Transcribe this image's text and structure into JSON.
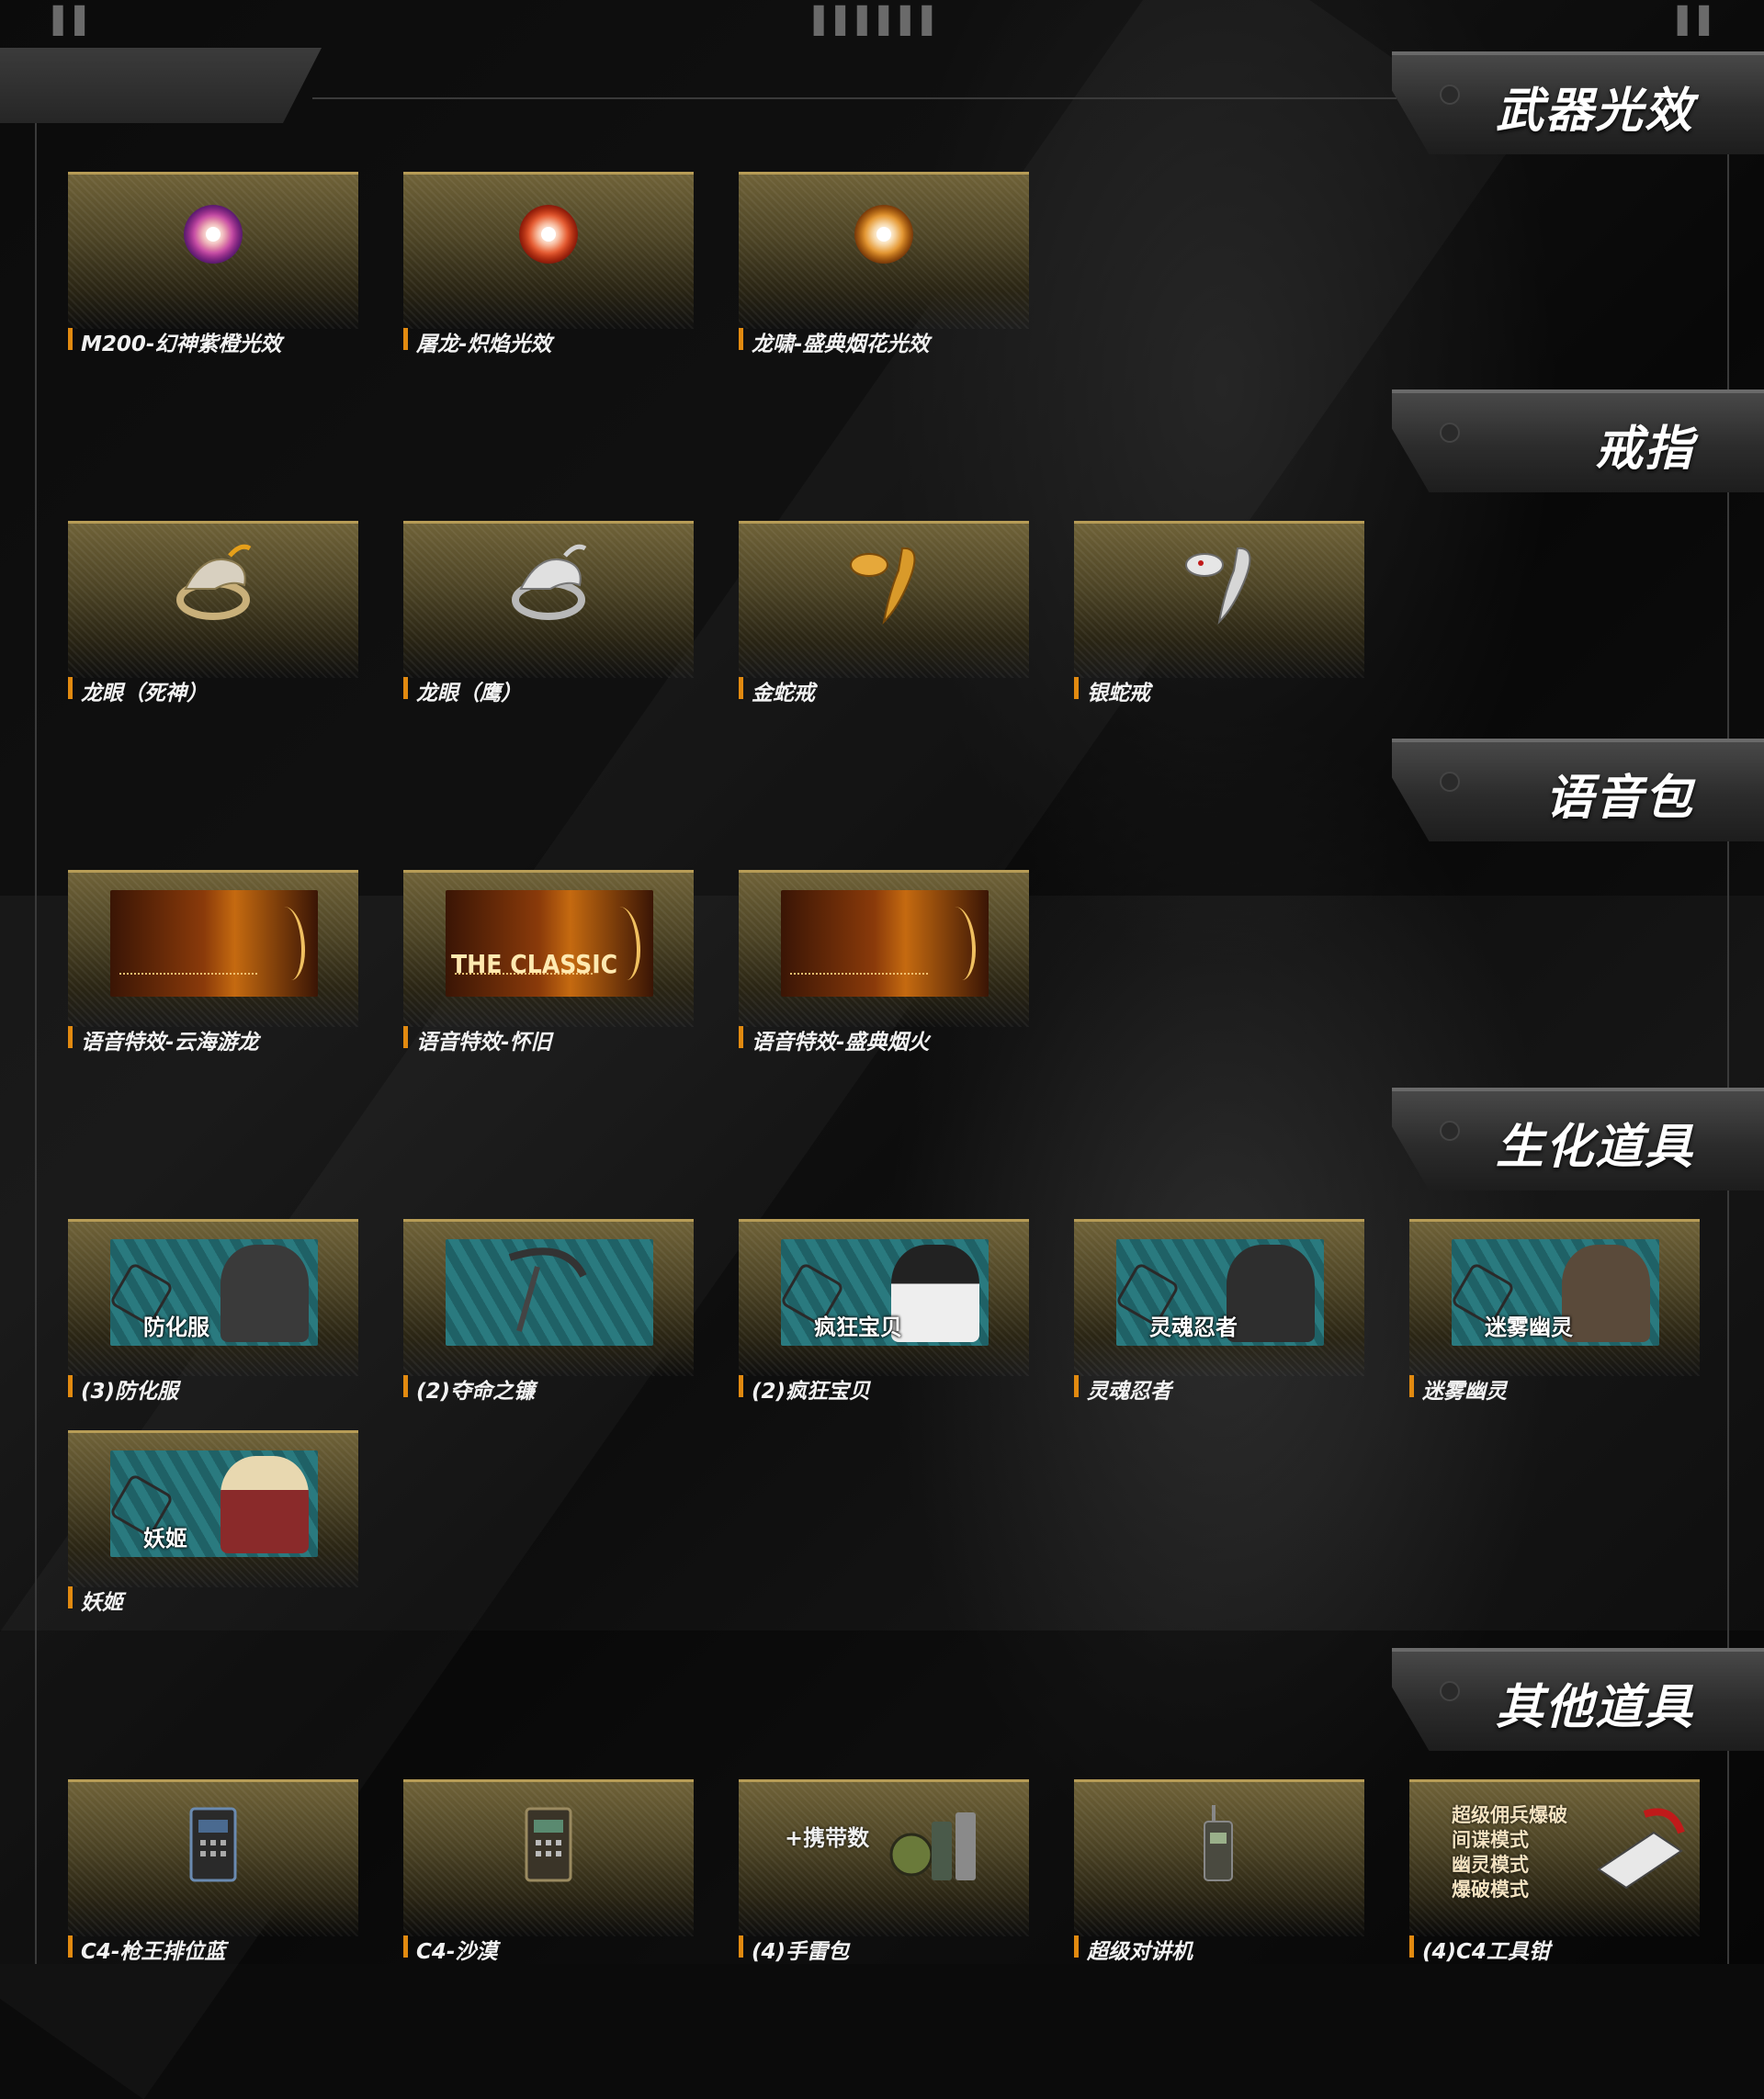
{
  "top_marks": {
    "left": "▌▌",
    "center": "▌▌▌▌▌▌",
    "right": "▌▌"
  },
  "colors": {
    "accent": "#e28a10",
    "card_gold": "#b79c56",
    "banner_text": "#ffffff"
  },
  "sections": [
    {
      "title": "武器光效",
      "items": [
        {
          "label": "M200-幻神紫橙光效",
          "icon": "purple-orange-glow-icon"
        },
        {
          "label": "屠龙-炽焰光效",
          "icon": "red-flame-glow-icon"
        },
        {
          "label": "龙啸-盛典烟花光效",
          "icon": "orange-firework-glow-icon"
        }
      ]
    },
    {
      "title": "戒指",
      "items": [
        {
          "label": "龙眼（死神）",
          "icon": "dragon-ring-gold-icon"
        },
        {
          "label": "龙眼（鹰）",
          "icon": "dragon-ring-silver-icon"
        },
        {
          "label": "金蛇戒",
          "icon": "gold-snake-ring-icon"
        },
        {
          "label": "银蛇戒",
          "icon": "silver-snake-ring-icon"
        }
      ]
    },
    {
      "title": "语音包",
      "items": [
        {
          "label": "语音特效-云海游龙",
          "icon": "voice-dragon-thumb",
          "caption": ""
        },
        {
          "label": "语音特效-怀旧",
          "icon": "voice-classic-thumb",
          "caption": "THE CLASSIC"
        },
        {
          "label": "语音特效-盛典烟火",
          "icon": "voice-firework-thumb",
          "caption": ""
        }
      ]
    },
    {
      "title": "生化道具",
      "items": [
        {
          "label": "(3)防化服",
          "icon": "hazmat-suit-thumb",
          "caption": "防化服"
        },
        {
          "label": "(2)夺命之镰",
          "icon": "scythe-thumb",
          "caption": ""
        },
        {
          "label": "(2)疯狂宝贝",
          "icon": "crazy-baby-thumb",
          "caption": "疯狂宝贝"
        },
        {
          "label": "灵魂忍者",
          "icon": "soul-ninja-thumb",
          "caption": "灵魂忍者"
        },
        {
          "label": "迷雾幽灵",
          "icon": "mist-ghost-thumb",
          "caption": "迷雾幽灵"
        },
        {
          "label": "妖姬",
          "icon": "siren-thumb",
          "caption": "妖姬"
        }
      ]
    },
    {
      "title": "其他道具",
      "items": [
        {
          "label": "C4-枪王排位蓝",
          "icon": "c4-blue-icon"
        },
        {
          "label": "C4-沙漠",
          "icon": "c4-desert-icon"
        },
        {
          "label": "(4)手雷包",
          "icon": "grenade-pack-icon",
          "caption": "+携带数"
        },
        {
          "label": "超级对讲机",
          "icon": "walkie-talkie-icon"
        },
        {
          "label": "(4)C4工具钳",
          "icon": "c4-pliers-icon",
          "caption_lines": [
            "超级佣兵爆破",
            "间谍模式",
            "幽灵模式",
            "爆破模式"
          ]
        }
      ]
    }
  ]
}
